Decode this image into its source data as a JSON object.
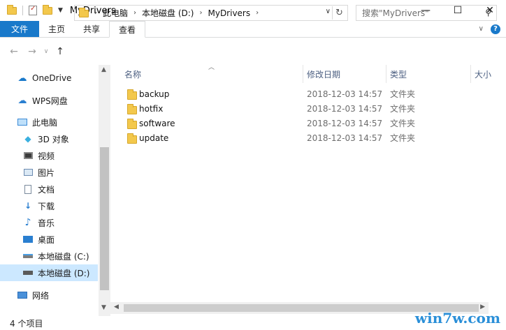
{
  "window": {
    "title": "MyDrivers",
    "controls": {
      "minimize": "—",
      "maximize": "☐",
      "close": "✕"
    }
  },
  "ribbon": {
    "tabs": [
      {
        "label": "文件"
      },
      {
        "label": "主页"
      },
      {
        "label": "共享"
      },
      {
        "label": "查看"
      }
    ],
    "help": "?"
  },
  "address": {
    "crumbs": [
      "此电脑",
      "本地磁盘 (D:)",
      "MyDrivers"
    ]
  },
  "search": {
    "placeholder": "搜索\"MyDrivers\""
  },
  "nav": {
    "items": [
      {
        "label": "OneDrive",
        "icon": "cloud-icon"
      },
      {
        "label": "WPS网盘",
        "icon": "cloud-outline-icon"
      },
      {
        "label": "此电脑",
        "icon": "computer-icon"
      },
      {
        "label": "3D 对象",
        "icon": "cube-icon"
      },
      {
        "label": "视频",
        "icon": "video-icon"
      },
      {
        "label": "图片",
        "icon": "picture-icon"
      },
      {
        "label": "文档",
        "icon": "document-icon"
      },
      {
        "label": "下载",
        "icon": "download-icon"
      },
      {
        "label": "音乐",
        "icon": "music-icon"
      },
      {
        "label": "桌面",
        "icon": "desktop-icon"
      },
      {
        "label": "本地磁盘 (C:)",
        "icon": "drive-c-icon"
      },
      {
        "label": "本地磁盘 (D:)",
        "icon": "drive-d-icon",
        "selected": true
      },
      {
        "label": "网络",
        "icon": "network-icon"
      }
    ]
  },
  "columns": {
    "name": "名称",
    "date": "修改日期",
    "type": "类型",
    "size": "大小"
  },
  "files": [
    {
      "name": "backup",
      "date": "2018-12-03 14:57",
      "type": "文件夹"
    },
    {
      "name": "hotfix",
      "date": "2018-12-03 14:57",
      "type": "文件夹"
    },
    {
      "name": "software",
      "date": "2018-12-03 14:57",
      "type": "文件夹"
    },
    {
      "name": "update",
      "date": "2018-12-03 14:57",
      "type": "文件夹"
    }
  ],
  "status": {
    "count": "4 个项目"
  },
  "watermark": "win7w.com",
  "colors": {
    "accent": "#1979ca",
    "selection": "#cce8ff",
    "folder": "#f3c84c"
  }
}
